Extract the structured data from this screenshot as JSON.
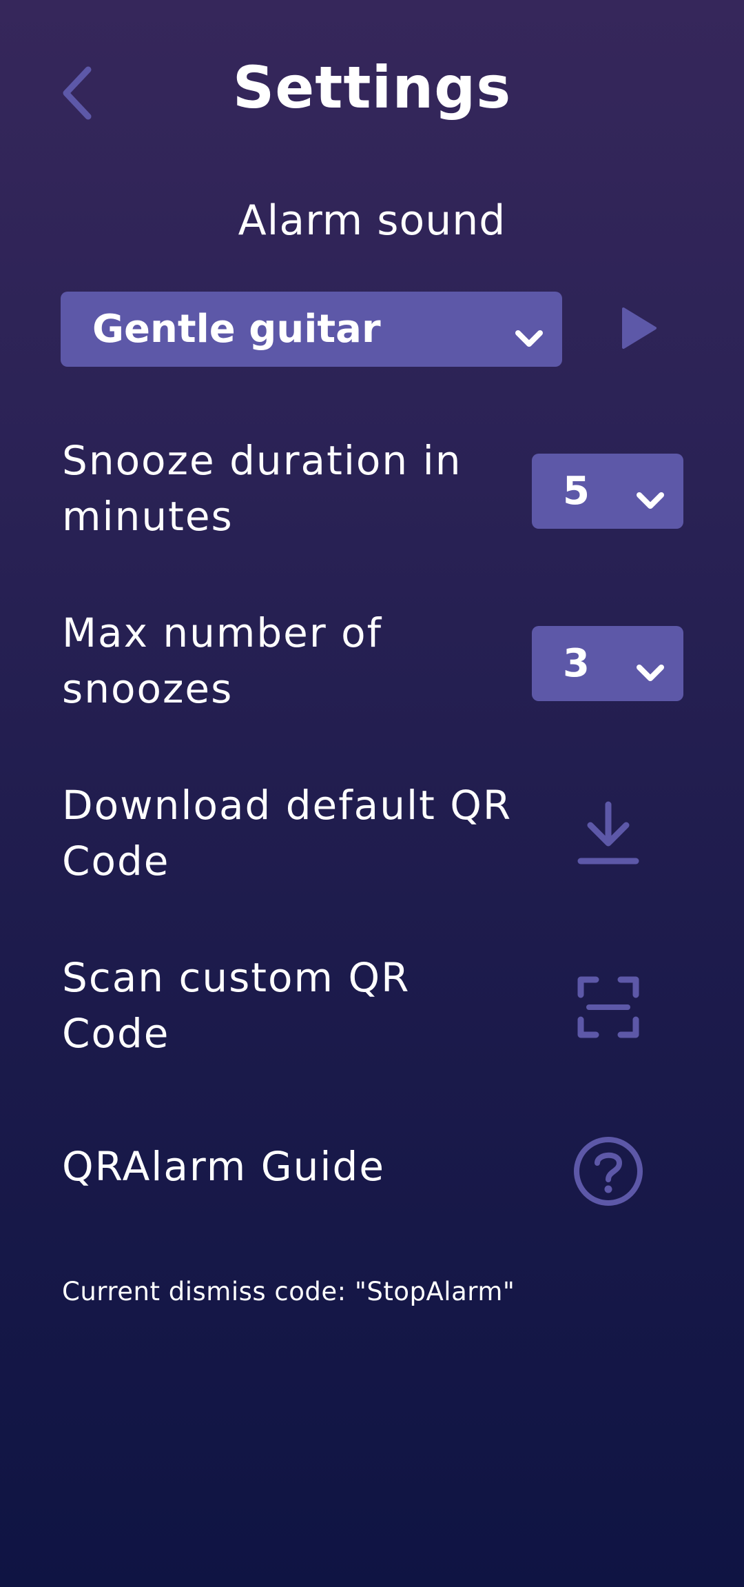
{
  "header": {
    "title": "Settings",
    "back_icon": "chevron-left-icon"
  },
  "alarm_sound": {
    "label": "Alarm sound",
    "selected": "Gentle guitar",
    "play_icon": "play-icon"
  },
  "snooze_duration": {
    "label": "Snooze duration in minutes",
    "selected": "5"
  },
  "max_snoozes": {
    "label": "Max number of snoozes",
    "selected": "3"
  },
  "download_qr": {
    "label": "Download default QR Code",
    "icon": "download-icon"
  },
  "scan_qr": {
    "label": "Scan custom QR Code",
    "icon": "qr-scan-icon"
  },
  "guide": {
    "label": "QRAlarm Guide",
    "icon": "help-circle-icon"
  },
  "dismiss_code": "Current dismiss code: \"StopAlarm\"",
  "colors": {
    "accent": "#5d58a8",
    "icon": "#5d58a8",
    "background_top": "#36275b",
    "background_bottom": "#0f1443",
    "text": "#ffffff"
  }
}
